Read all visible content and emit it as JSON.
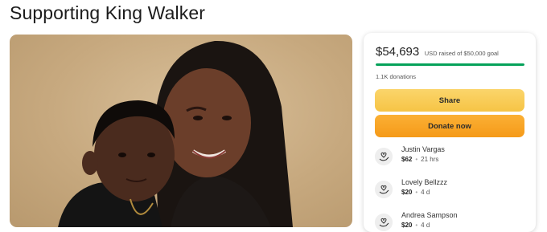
{
  "page": {
    "title": "Supporting King Walker"
  },
  "campaign": {
    "raised_amount": "$54,693",
    "raised_caption": "USD raised of $50,000 goal",
    "progress_fraction": 1.0,
    "donation_count": "1.1K donations",
    "share_label": "Share",
    "donate_label": "Donate now"
  },
  "donors": [
    {
      "name": "Justin Vargas",
      "amount": "$62",
      "time": "21 hrs",
      "icon": "heart-hand-icon"
    },
    {
      "name": "Lovely Bellzzz",
      "amount": "$20",
      "time": "4 d",
      "icon": "heart-hand-icon"
    },
    {
      "name": "Andrea Sampson",
      "amount": "$20",
      "time": "4 d",
      "icon": "heart-hand-icon"
    }
  ],
  "colors": {
    "progress": "#05a25a",
    "share_button": "#f6c445",
    "donate_button": "#f59a19"
  }
}
